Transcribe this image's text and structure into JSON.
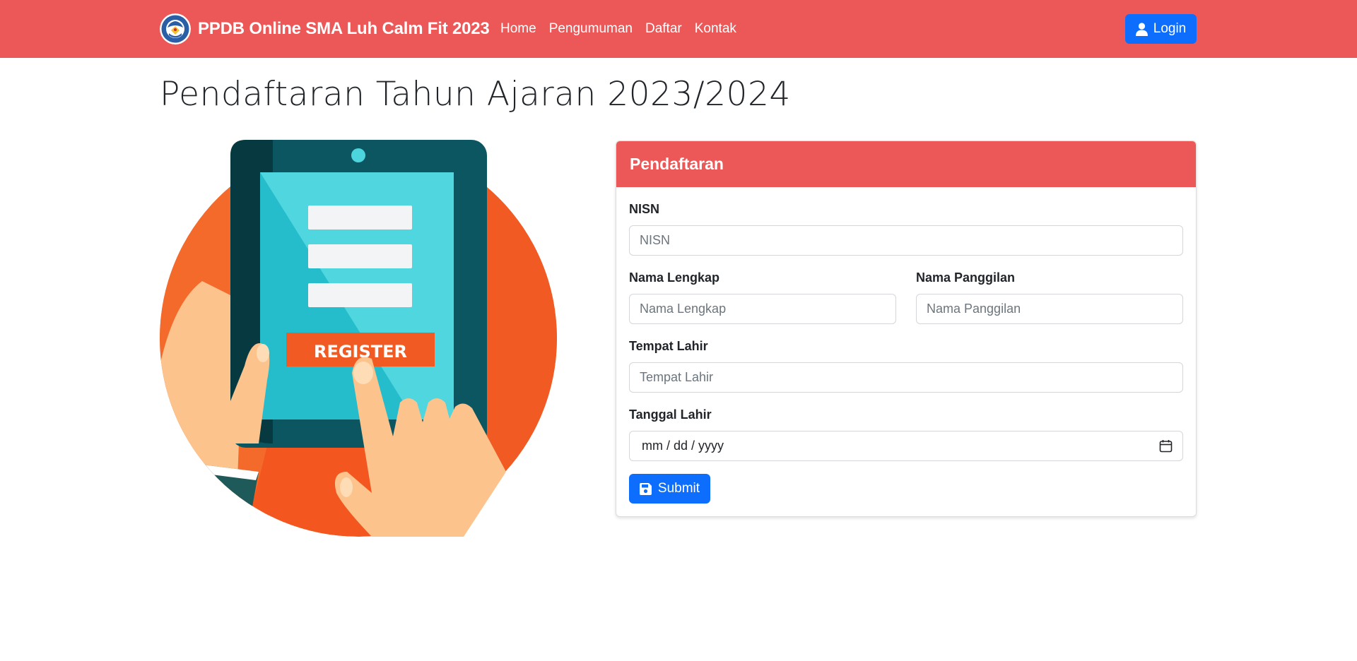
{
  "navbar": {
    "brand": "PPDB Online SMA Luh Calm Fit 2023",
    "links": [
      "Home",
      "Pengumuman",
      "Daftar",
      "Kontak"
    ],
    "login_label": "Login"
  },
  "page_title": "Pendaftaran Tahun Ajaran 2023/2024",
  "illustration": {
    "button_text": "REGISTER"
  },
  "form": {
    "header": "Pendaftaran",
    "nisn_label": "NISN",
    "nisn_placeholder": "NISN",
    "nama_lengkap_label": "Nama Lengkap",
    "nama_lengkap_placeholder": "Nama Lengkap",
    "nama_panggilan_label": "Nama Panggilan",
    "nama_panggilan_placeholder": "Nama Panggilan",
    "tempat_lahir_label": "Tempat Lahir",
    "tempat_lahir_placeholder": "Tempat Lahir",
    "tanggal_lahir_label": "Tanggal Lahir",
    "tanggal_lahir_value": "mm / dd / yyyy",
    "submit_label": "Submit"
  },
  "colors": {
    "navbar": "#ec5858",
    "primary": "#0d6efd",
    "card_header": "#ec5858"
  }
}
